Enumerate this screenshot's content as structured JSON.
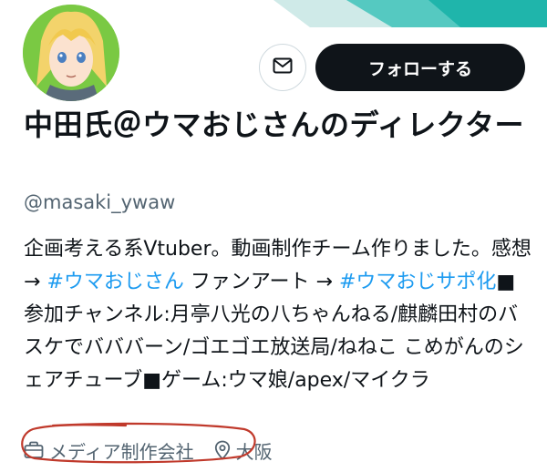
{
  "profile": {
    "display_name": "中田氏＠ウマおじさんのディレクター",
    "handle": "@masaki_ywaw",
    "follow_label": "フォローする",
    "message_icon": "envelope-icon",
    "avatar_icon": "avatar-illustration"
  },
  "bio": {
    "segments": [
      {
        "text": "企画考える系Vtuber。動画制作チーム作りました。感想 → ",
        "link": false
      },
      {
        "text": "#ウマおじさん",
        "link": true
      },
      {
        "text": " ファンアート → ",
        "link": false
      },
      {
        "text": "#ウマおじサポ化",
        "link": true
      },
      {
        "text": "■参加チャンネル:月亭八光の八ちゃんねる/麒麟田村のバスケでバババーン/ゴエゴエ放送局/ねねこ こめがんのシェアチューブ■ゲーム:ウマ娘/apex/マイクラ",
        "link": false
      }
    ]
  },
  "meta": {
    "category": "メディア制作会社",
    "category_icon": "briefcase-icon",
    "location": "大阪",
    "location_icon": "location-pin-icon"
  },
  "colors": {
    "link": "#1d9bf0",
    "follow_bg": "#0f1419",
    "secondary_text": "#536471",
    "annotation": "#c0392b"
  }
}
